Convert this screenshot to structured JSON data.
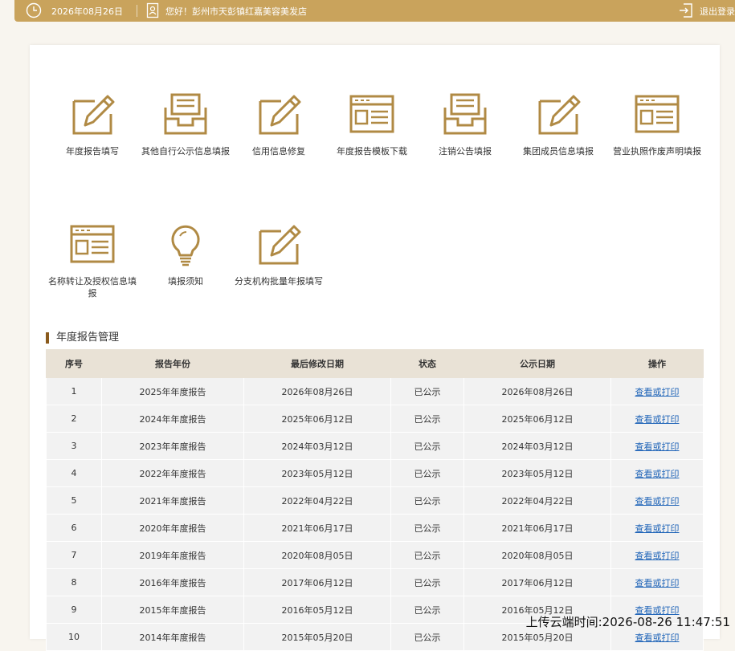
{
  "header": {
    "date": "2026年08月26日",
    "greeting": "您好！彭州市天彭镇红嘉美容美发店",
    "logout_label": "退出登录",
    "accent_color": "#c9a35c"
  },
  "menu": [
    {
      "label": "年度报告填写",
      "icon": "edit-icon"
    },
    {
      "label": "其他自行公示信息填报",
      "icon": "inbox-icon"
    },
    {
      "label": "信用信息修复",
      "icon": "edit-icon"
    },
    {
      "label": "年度报告模板下载",
      "icon": "browser-window-icon"
    },
    {
      "label": "注销公告填报",
      "icon": "inbox-icon"
    },
    {
      "label": "集团成员信息填报",
      "icon": "edit-icon"
    },
    {
      "label": "营业执照作废声明填报",
      "icon": "browser-window-icon"
    },
    {
      "label": "名称转让及授权信息填报",
      "icon": "browser-window-icon"
    },
    {
      "label": "填报须知",
      "icon": "lightbulb-icon"
    },
    {
      "label": "分支机构批量年报填写",
      "icon": "edit-icon"
    }
  ],
  "section_title": "年度报告管理",
  "table": {
    "columns": [
      "序号",
      "报告年份",
      "最后修改日期",
      "状态",
      "公示日期",
      "操作"
    ],
    "rows": [
      {
        "no": "1",
        "year": "2025年年度报告",
        "modified": "2026年08月26日",
        "status": "已公示",
        "published": "2026年08月26日",
        "action": "查看或打印"
      },
      {
        "no": "2",
        "year": "2024年年度报告",
        "modified": "2025年06月12日",
        "status": "已公示",
        "published": "2025年06月12日",
        "action": "查看或打印"
      },
      {
        "no": "3",
        "year": "2023年年度报告",
        "modified": "2024年03月12日",
        "status": "已公示",
        "published": "2024年03月12日",
        "action": "查看或打印"
      },
      {
        "no": "4",
        "year": "2022年年度报告",
        "modified": "2023年05月12日",
        "status": "已公示",
        "published": "2023年05月12日",
        "action": "查看或打印"
      },
      {
        "no": "5",
        "year": "2021年年度报告",
        "modified": "2022年04月22日",
        "status": "已公示",
        "published": "2022年04月22日",
        "action": "查看或打印"
      },
      {
        "no": "6",
        "year": "2020年年度报告",
        "modified": "2021年06月17日",
        "status": "已公示",
        "published": "2021年06月17日",
        "action": "查看或打印"
      },
      {
        "no": "7",
        "year": "2019年年度报告",
        "modified": "2020年08月05日",
        "status": "已公示",
        "published": "2020年08月05日",
        "action": "查看或打印"
      },
      {
        "no": "8",
        "year": "2016年年度报告",
        "modified": "2017年06月12日",
        "status": "已公示",
        "published": "2017年06月12日",
        "action": "查看或打印"
      },
      {
        "no": "9",
        "year": "2015年年度报告",
        "modified": "2016年05月12日",
        "status": "已公示",
        "published": "2016年05月12日",
        "action": "查看或打印"
      },
      {
        "no": "10",
        "year": "2014年年度报告",
        "modified": "2015年05月20日",
        "status": "已公示",
        "published": "2015年05月20日",
        "action": "查看或打印"
      }
    ]
  },
  "overlay": {
    "upload_time": "上传云端时间:2026-08-26 11:47:51"
  }
}
